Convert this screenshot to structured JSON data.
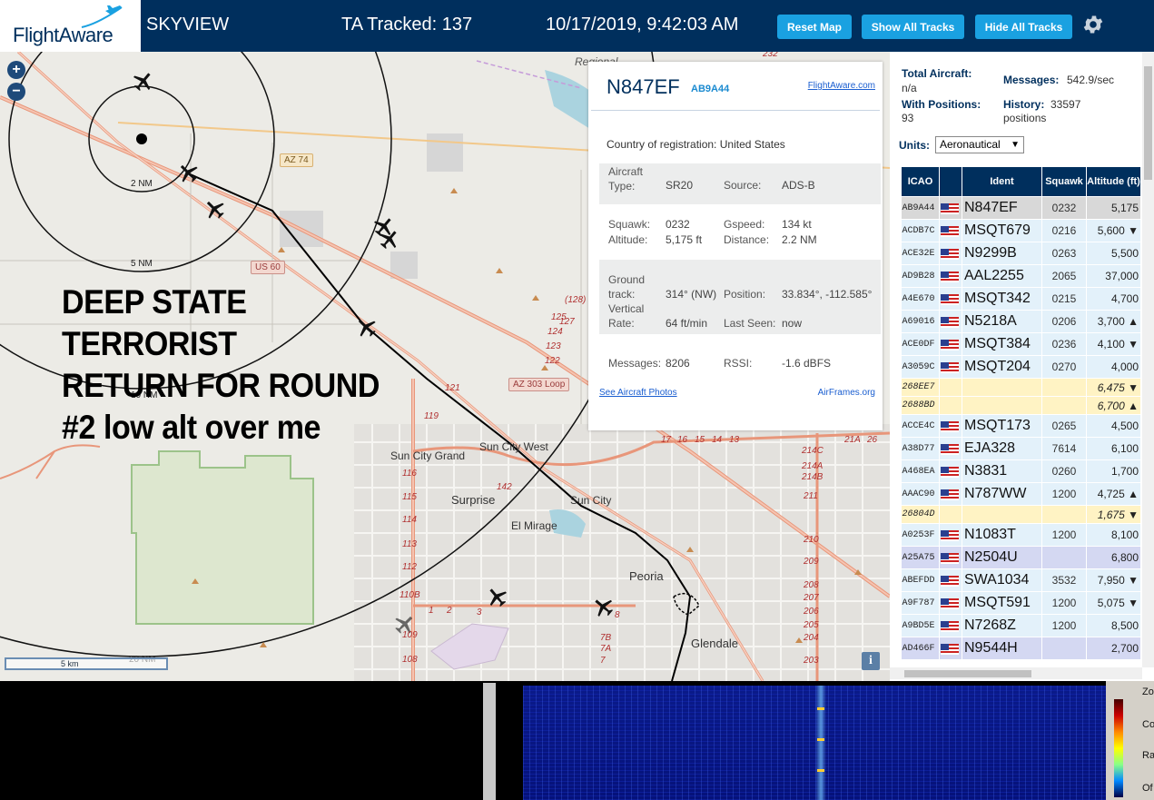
{
  "header": {
    "logo_text": "FlightAware",
    "app_name": "SKYVIEW",
    "tracked": "TA Tracked: 137",
    "datetime": "10/17/2019, 9:42:03 AM",
    "buttons": {
      "reset": "Reset Map",
      "show_all": "Show All Tracks",
      "hide_all": "Hide All Tracks"
    },
    "settings_icon": "gear-icon"
  },
  "map": {
    "zoom_in": "+",
    "zoom_out": "−",
    "overlay_text": [
      "DEEP STATE",
      "TERRORIST",
      "RETURN FOR ROUND",
      "#2 low alt over me"
    ],
    "range_labels": [
      "2 NM",
      "5 NM",
      "10 NM",
      "20 NM"
    ],
    "road_badges": [
      "AZ 74",
      "US 60",
      "AZ 303 Loop"
    ],
    "places": [
      "Sun City Grand",
      "Sun City West",
      "Surprise",
      "Sun City",
      "El Mirage",
      "Peoria",
      "Glendale",
      "Regional"
    ],
    "exit_numbers": [
      "116",
      "115",
      "114",
      "113",
      "112",
      "110B",
      "109",
      "108",
      "119",
      "121",
      "122",
      "123",
      "124",
      "125",
      "127",
      "(128)",
      "142",
      "1",
      "2",
      "3",
      "7B",
      "7A",
      "17",
      "16",
      "15",
      "14",
      "13",
      "214C",
      "214A",
      "214B",
      "211",
      "210",
      "209",
      "208",
      "207",
      "206",
      "205",
      "204",
      "203",
      "8",
      "7",
      "21A",
      "26",
      "232"
    ],
    "scale_label": "5 km",
    "info_button": "i"
  },
  "popup": {
    "ident": "N847EF",
    "hex": "AB9A44",
    "fa_link": "FlightAware.com",
    "country_label": "Country of registration:",
    "country": "United States",
    "aircraft_type_label": "Aircraft Type:",
    "aircraft_type": "SR20",
    "source_label": "Source:",
    "source": "ADS-B",
    "squawk_label": "Squawk:",
    "squawk": "0232",
    "gspeed_label": "Gspeed:",
    "gspeed": "134 kt",
    "altitude_label": "Altitude:",
    "altitude": "5,175 ft",
    "distance_label": "Distance:",
    "distance": "2.2 NM",
    "ground_track_label": "Ground track:",
    "ground_track": "314° (NW)",
    "position_label": "Position:",
    "position": "33.834°, -112.585°",
    "vertical_rate_label": "Vertical Rate:",
    "vertical_rate": "64 ft/min",
    "last_seen_label": "Last Seen:",
    "last_seen": "now",
    "messages_label": "Messages:",
    "messages": "8206",
    "rssi_label": "RSSI:",
    "rssi": "-1.6 dBFS",
    "photos_link": "See Aircraft Photos",
    "airframes_link": "AirFrames.org"
  },
  "sidebar": {
    "total_label": "Total Aircraft:",
    "total": "n/a",
    "messages_label": "Messages:",
    "messages": "542.9/sec",
    "positions_label": "With Positions:",
    "positions": "93",
    "history_label": "History:",
    "history": "33597 positions",
    "units_label": "Units:",
    "units_value": "Aeronautical",
    "columns": [
      "ICAO",
      "",
      "Ident",
      "Squawk",
      "Altitude (ft)"
    ],
    "rows": [
      {
        "icao": "AB9A44",
        "ident": "N847EF",
        "squawk": "0232",
        "alt": "5,175",
        "style": "sel",
        "flag": true
      },
      {
        "icao": "ACDB7C",
        "ident": "MSQT679",
        "squawk": "0216",
        "alt": "5,600 ▼",
        "style": "blue",
        "flag": true
      },
      {
        "icao": "ACE32E",
        "ident": "N9299B",
        "squawk": "0263",
        "alt": "5,500",
        "style": "blue",
        "flag": true
      },
      {
        "icao": "AD9B28",
        "ident": "AAL2255",
        "squawk": "2065",
        "alt": "37,000",
        "style": "blue",
        "flag": true
      },
      {
        "icao": "A4E670",
        "ident": "MSQT342",
        "squawk": "0215",
        "alt": "4,700",
        "style": "blue",
        "flag": true
      },
      {
        "icao": "A69016",
        "ident": "N5218A",
        "squawk": "0206",
        "alt": "3,700 ▲",
        "style": "blue",
        "flag": true
      },
      {
        "icao": "ACE0DF",
        "ident": "MSQT384",
        "squawk": "0236",
        "alt": "4,100 ▼",
        "style": "blue",
        "flag": true
      },
      {
        "icao": "A3059C",
        "ident": "MSQT204",
        "squawk": "0270",
        "alt": "4,000",
        "style": "blue",
        "flag": true
      },
      {
        "icao": "268EE7",
        "ident": "",
        "squawk": "",
        "alt": "6,475 ▼",
        "style": "yellow",
        "flag": false
      },
      {
        "icao": "2688BD",
        "ident": "",
        "squawk": "",
        "alt": "6,700 ▲",
        "style": "yellow",
        "flag": false
      },
      {
        "icao": "ACCE4C",
        "ident": "MSQT173",
        "squawk": "0265",
        "alt": "4,500",
        "style": "blue",
        "flag": true
      },
      {
        "icao": "A38D77",
        "ident": "EJA328",
        "squawk": "7614",
        "alt": "6,100",
        "style": "blue",
        "flag": true
      },
      {
        "icao": "A468EA",
        "ident": "N3831",
        "squawk": "0260",
        "alt": "1,700",
        "style": "blue",
        "flag": true
      },
      {
        "icao": "AAAC90",
        "ident": "N787WW",
        "squawk": "1200",
        "alt": "4,725 ▲",
        "style": "blue",
        "flag": true
      },
      {
        "icao": "26804D",
        "ident": "",
        "squawk": "",
        "alt": "1,675 ▼",
        "style": "yellow",
        "flag": false
      },
      {
        "icao": "A0253F",
        "ident": "N1083T",
        "squawk": "1200",
        "alt": "8,100",
        "style": "blue",
        "flag": true
      },
      {
        "icao": "A25A75",
        "ident": "N2504U",
        "squawk": "",
        "alt": "6,800",
        "style": "purple",
        "flag": true
      },
      {
        "icao": "ABEFDD",
        "ident": "SWA1034",
        "squawk": "3532",
        "alt": "7,950 ▼",
        "style": "blue",
        "flag": true
      },
      {
        "icao": "A9F787",
        "ident": "MSQT591",
        "squawk": "1200",
        "alt": "5,075 ▼",
        "style": "blue",
        "flag": true
      },
      {
        "icao": "A9BD5E",
        "ident": "N7268Z",
        "squawk": "1200",
        "alt": "8,500",
        "style": "blue",
        "flag": true
      },
      {
        "icao": "AD466F",
        "ident": "N9544H",
        "squawk": "",
        "alt": "2,700",
        "style": "purple",
        "flag": true
      }
    ]
  },
  "sdr": {
    "labels": [
      "Zo",
      "Co",
      "Ra",
      "Of"
    ]
  }
}
